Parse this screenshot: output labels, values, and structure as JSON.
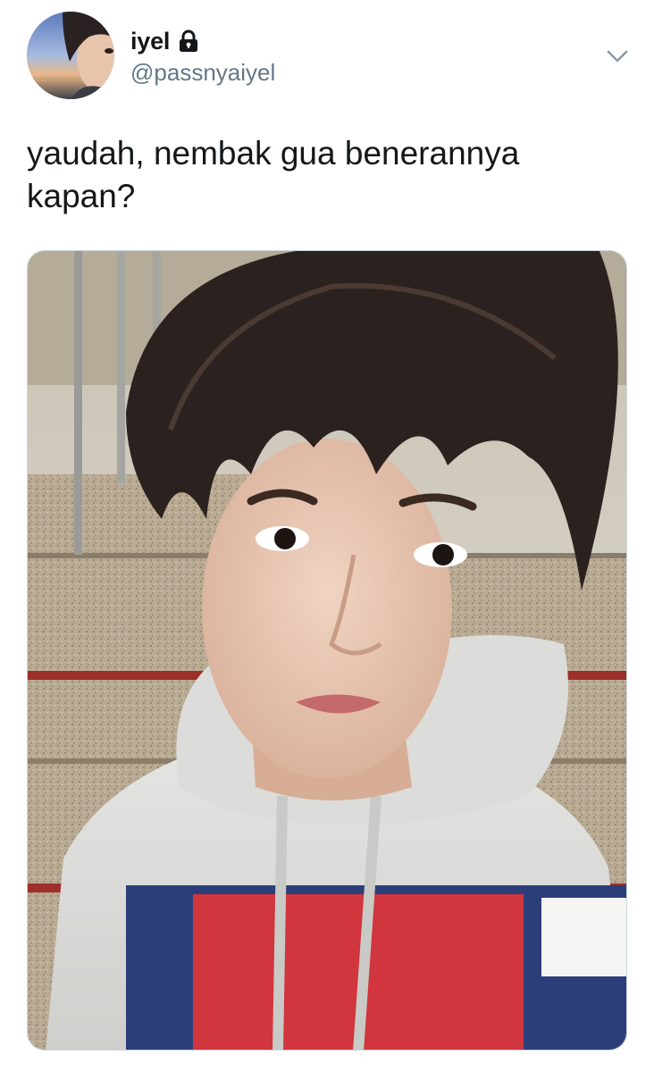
{
  "tweet": {
    "author": {
      "display_name": "iyel",
      "handle": "@passnyaiyel",
      "protected": true,
      "avatar_icon": "profile-photo"
    },
    "text_lines": [
      "yaudah, nembak gua benerannya",
      "kapan?"
    ],
    "menu_icon": "chevron-down-icon",
    "media": {
      "type": "photo",
      "icon": "selfie-photo"
    }
  },
  "colors": {
    "primary_text": "#14171a",
    "secondary_text": "#657786",
    "background": "#ffffff",
    "border": "#ccd6dd"
  }
}
